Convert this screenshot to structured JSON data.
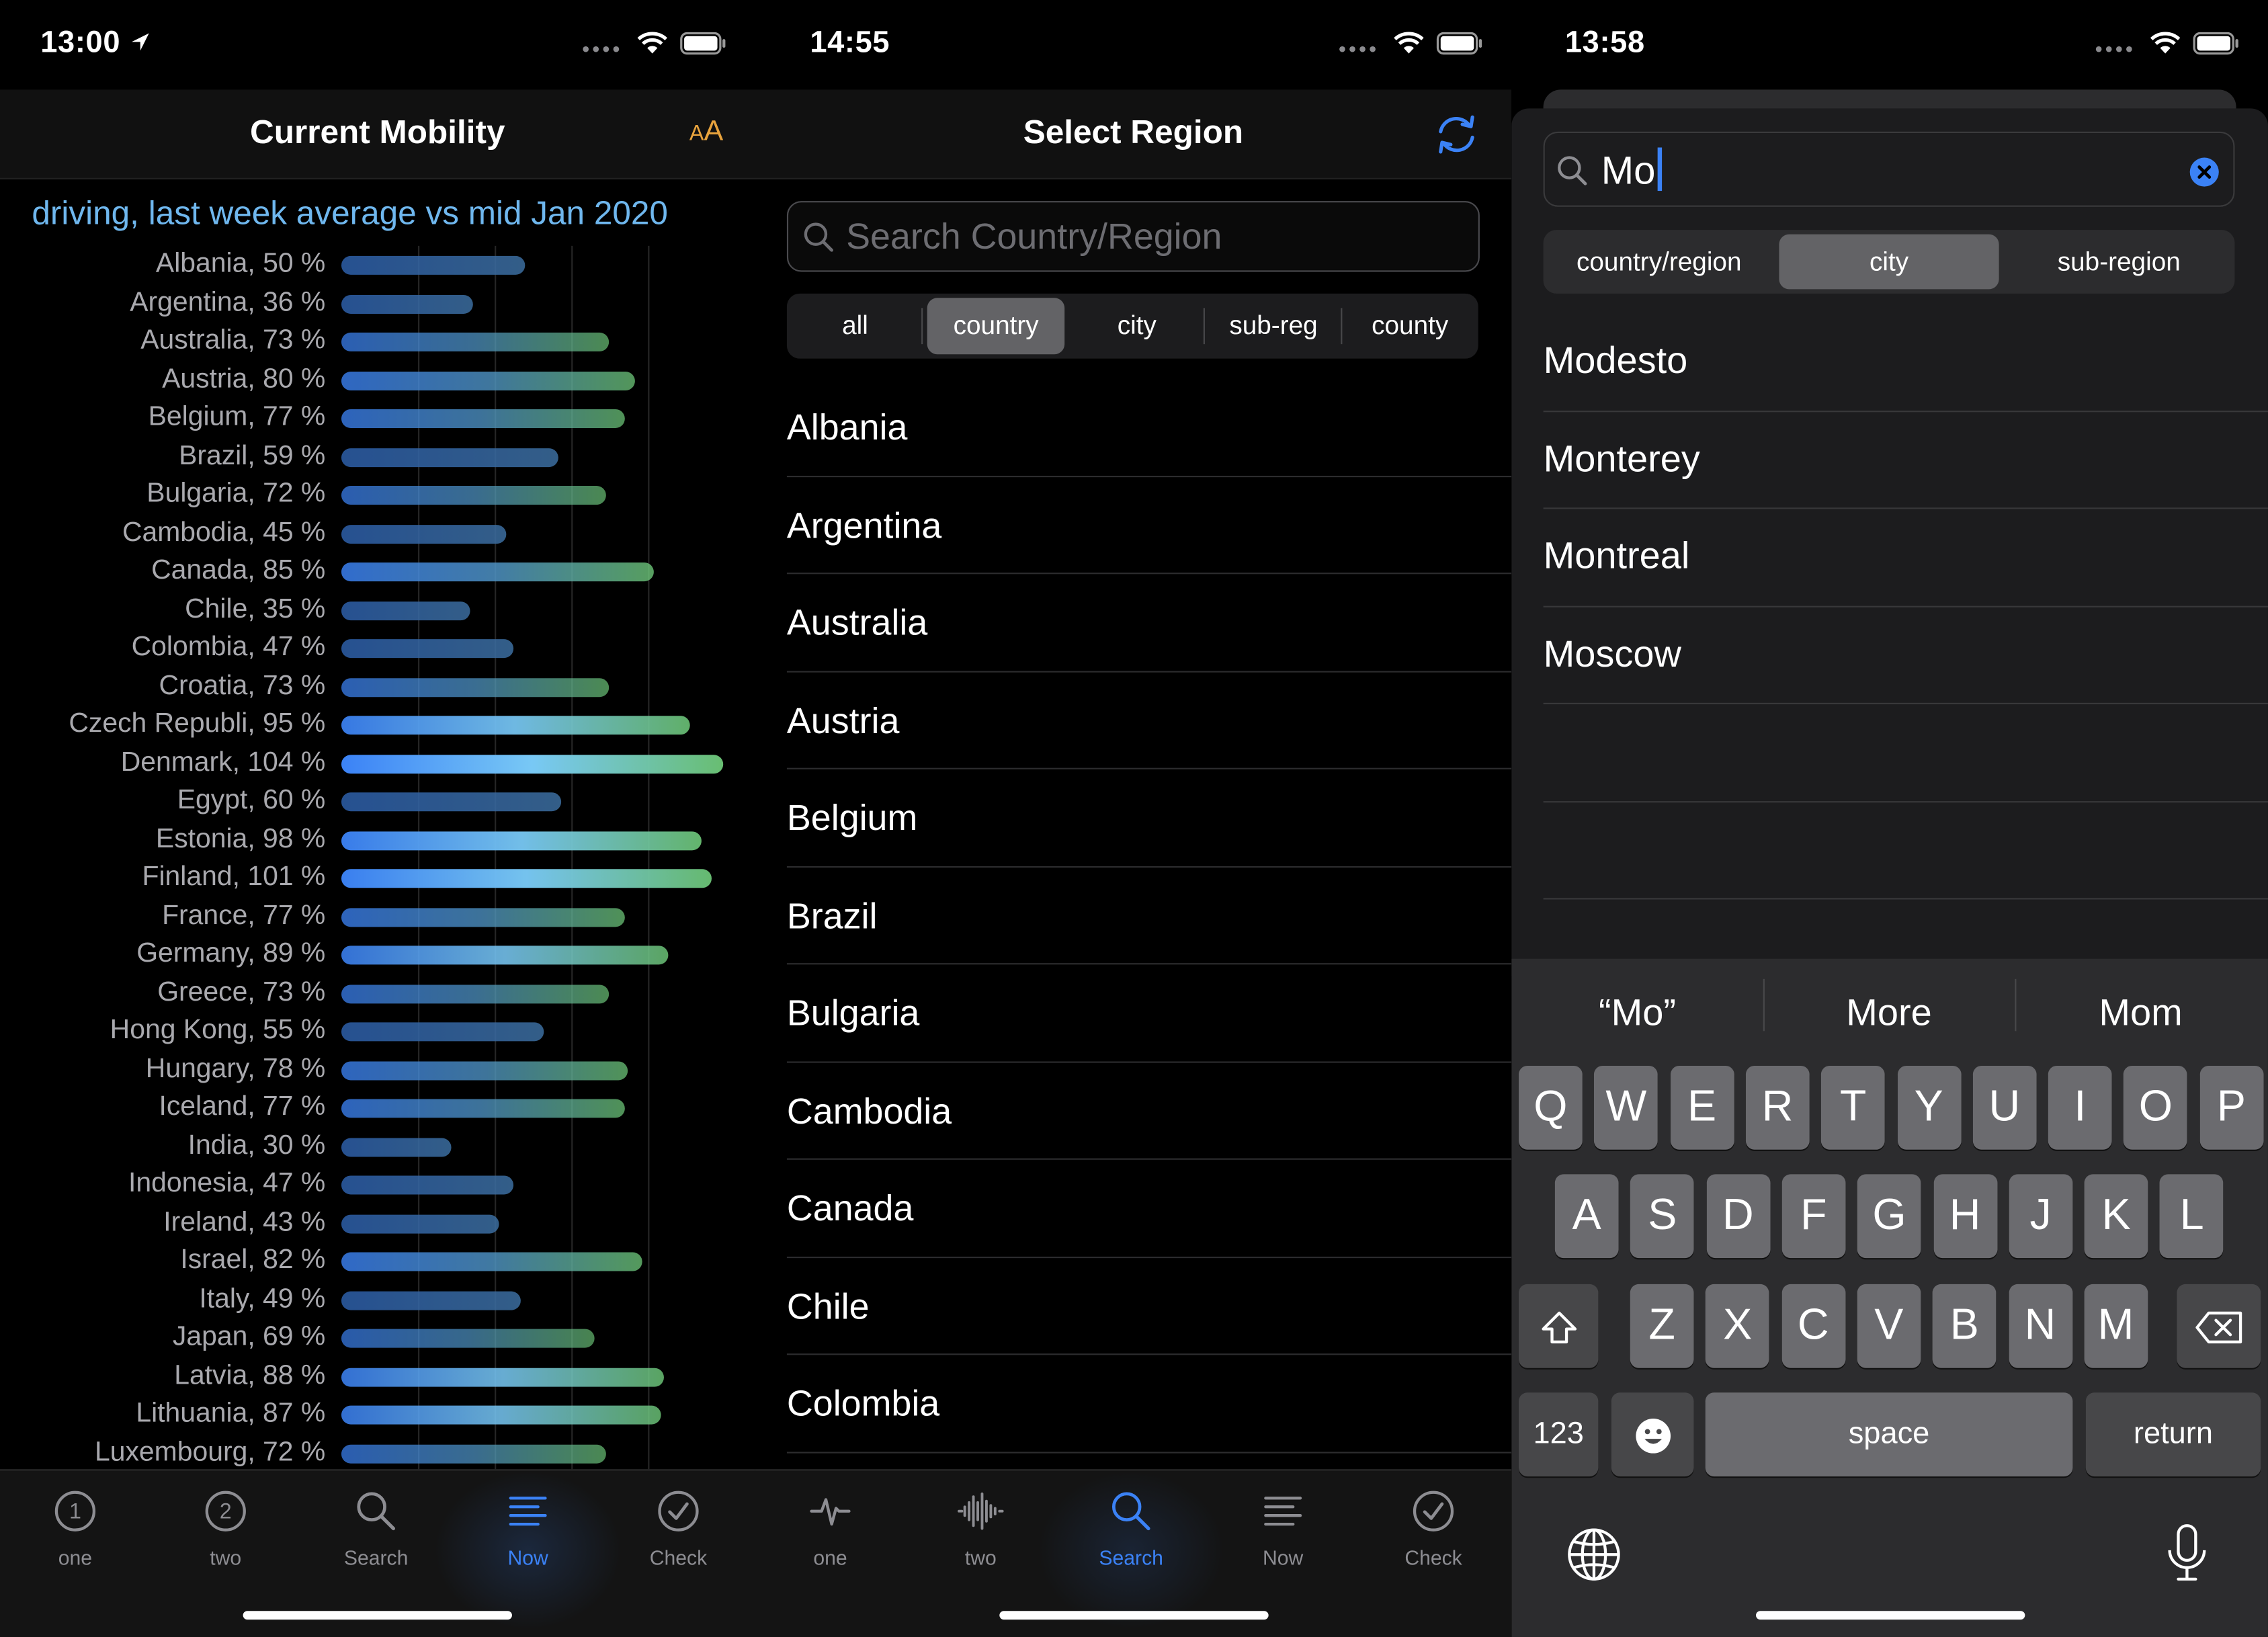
{
  "panel1": {
    "status_time": "13:00",
    "nav_title": "Current Mobility",
    "text_size_button": "AA",
    "subtitle": "driving, last week average vs mid Jan 2020",
    "tabs": [
      {
        "label": "one",
        "icon": "circle-1-icon"
      },
      {
        "label": "two",
        "icon": "circle-2-icon"
      },
      {
        "label": "Search",
        "icon": "search-icon"
      },
      {
        "label": "Now",
        "icon": "list-icon"
      },
      {
        "label": "Check",
        "icon": "checkmark-circle-icon"
      }
    ],
    "active_tab": 3
  },
  "chart_data": {
    "type": "bar",
    "orientation": "horizontal",
    "title": "driving, last week average vs mid Jan 2020",
    "unit": "%",
    "xlim": [
      0,
      104
    ],
    "grid": true,
    "categories": [
      "Albania",
      "Argentina",
      "Australia",
      "Austria",
      "Belgium",
      "Brazil",
      "Bulgaria",
      "Cambodia",
      "Canada",
      "Chile",
      "Colombia",
      "Croatia",
      "Czech Republi",
      "Denmark",
      "Egypt",
      "Estonia",
      "Finland",
      "France",
      "Germany",
      "Greece",
      "Hong Kong",
      "Hungary",
      "Iceland",
      "India",
      "Indonesia",
      "Ireland",
      "Israel",
      "Italy",
      "Japan",
      "Latvia",
      "Lithuania",
      "Luxembourg"
    ],
    "values": [
      50,
      36,
      73,
      80,
      77,
      59,
      72,
      45,
      85,
      35,
      47,
      73,
      95,
      104,
      60,
      98,
      101,
      77,
      89,
      73,
      55,
      78,
      77,
      30,
      47,
      43,
      82,
      49,
      69,
      88,
      87,
      72
    ],
    "labels": [
      "Albania, 50 %",
      "Argentina, 36 %",
      "Australia, 73 %",
      "Austria, 80 %",
      "Belgium, 77 %",
      "Brazil, 59 %",
      "Bulgaria, 72 %",
      "Cambodia, 45 %",
      "Canada, 85 %",
      "Chile, 35 %",
      "Colombia, 47 %",
      "Croatia, 73 %",
      "Czech Republi, 95 %",
      "Denmark, 104 %",
      "Egypt, 60 %",
      "Estonia, 98 %",
      "Finland, 101 %",
      "France, 77 %",
      "Germany, 89 %",
      "Greece, 73 %",
      "Hong Kong, 55 %",
      "Hungary, 78 %",
      "Iceland, 77 %",
      "India, 30 %",
      "Indonesia, 47 %",
      "Ireland, 43 %",
      "Israel, 82 %",
      "Italy, 49 %",
      "Japan, 69 %",
      "Latvia, 88 %",
      "Lithuania, 87 %",
      "Luxembourg, 72 %"
    ]
  },
  "panel2": {
    "status_time": "14:55",
    "nav_title": "Select Region",
    "search_placeholder": "Search Country/Region",
    "segments": [
      "all",
      "country",
      "city",
      "sub-reg",
      "county"
    ],
    "selected_segment": 1,
    "regions": [
      "Albania",
      "Argentina",
      "Australia",
      "Austria",
      "Belgium",
      "Brazil",
      "Bulgaria",
      "Cambodia",
      "Canada",
      "Chile",
      "Colombia"
    ],
    "tabs": [
      {
        "label": "one",
        "icon": "pulse-icon"
      },
      {
        "label": "two",
        "icon": "waveform-icon"
      },
      {
        "label": "Search",
        "icon": "search-icon"
      },
      {
        "label": "Now",
        "icon": "list-icon"
      },
      {
        "label": "Check",
        "icon": "checkmark-circle-icon"
      }
    ],
    "active_tab": 2
  },
  "panel3": {
    "status_time": "13:58",
    "search_value": "Mo",
    "segments": [
      "country/region",
      "city",
      "sub-region"
    ],
    "selected_segment": 1,
    "results": [
      "Modesto",
      "Monterey",
      "Montreal",
      "Moscow"
    ],
    "suggestions": [
      "“Mo”",
      "More",
      "Mom"
    ],
    "keyboard": {
      "row1": [
        "Q",
        "W",
        "E",
        "R",
        "T",
        "Y",
        "U",
        "I",
        "O",
        "P"
      ],
      "row2": [
        "A",
        "S",
        "D",
        "F",
        "G",
        "H",
        "J",
        "K",
        "L"
      ],
      "row3": [
        "Z",
        "X",
        "C",
        "V",
        "B",
        "N",
        "M"
      ],
      "numbers_key": "123",
      "space_key": "space",
      "return_key": "return"
    }
  },
  "colors": {
    "accent_blue": "#3b82f6",
    "subtitle_blue": "#6fb7ee",
    "text_size_orange": "#e8a33d"
  }
}
